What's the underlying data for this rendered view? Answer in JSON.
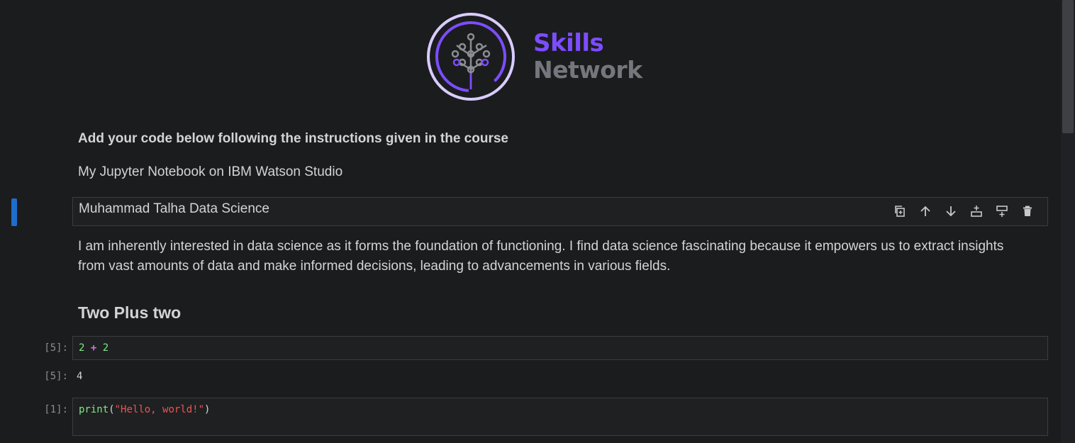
{
  "logo": {
    "word1": "Skills",
    "word2": "Network"
  },
  "heading": "Add your code below following the instructions given in the course",
  "subtitle": "My Jupyter Notebook on IBM Watson Studio",
  "selected_cell": {
    "text": "Muhammad Talha Data Science"
  },
  "toolbar": {
    "items": [
      {
        "name": "duplicate-cell-icon"
      },
      {
        "name": "move-up-icon"
      },
      {
        "name": "move-down-icon"
      },
      {
        "name": "insert-above-icon"
      },
      {
        "name": "insert-below-icon"
      },
      {
        "name": "delete-icon"
      }
    ]
  },
  "paragraph": "I am inherently interested in data science as it forms the foundation of functioning. I find data science fascinating because it empowers us to extract insights from vast amounts of data and make informed decisions, leading to advancements in various fields.",
  "section_heading": "Two Plus two",
  "code_cells": [
    {
      "prompt": "[5]:",
      "tok1": "2",
      "tok2": "+",
      "tok3": "2",
      "output_prompt": "[5]:",
      "output": "4"
    },
    {
      "prompt": "[1]:",
      "fn": "print",
      "open": "(",
      "str": "\"Hello, world!\"",
      "close": ")"
    }
  ],
  "colors": {
    "accent": "#7c4dff",
    "active_bar": "#1f6ecb",
    "background": "#1b1c1e"
  }
}
